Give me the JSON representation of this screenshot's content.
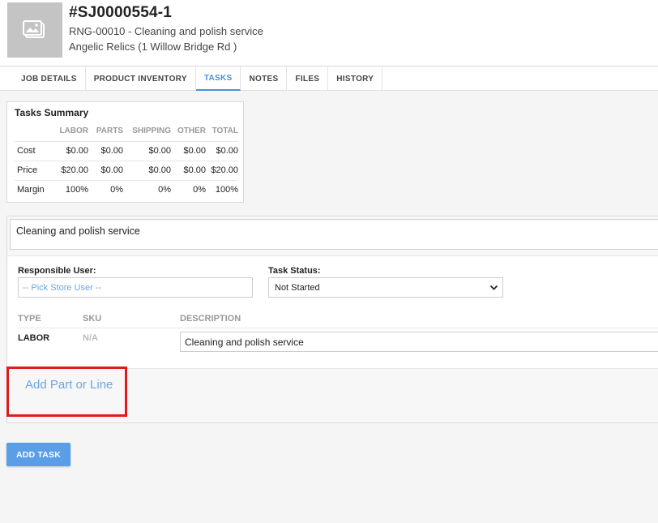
{
  "job": {
    "number": "#SJ0000554-1",
    "subtitle": "RNG-00010 - Cleaning and polish service",
    "customer": "Angelic Relics (1 Willow Bridge Rd )",
    "thumbnail_icon": "image-placeholder-icon"
  },
  "tabs": [
    {
      "label": "JOB DETAILS",
      "active": false
    },
    {
      "label": "PRODUCT INVENTORY",
      "active": false
    },
    {
      "label": "TASKS",
      "active": true
    },
    {
      "label": "NOTES",
      "active": false
    },
    {
      "label": "FILES",
      "active": false
    },
    {
      "label": "HISTORY",
      "active": false
    }
  ],
  "summary": {
    "title": "Tasks Summary",
    "columns": [
      "LABOR",
      "PARTS",
      "SHIPPING",
      "OTHER",
      "TOTAL"
    ],
    "rows": [
      {
        "label": "Cost",
        "values": [
          "$0.00",
          "$0.00",
          "$0.00",
          "$0.00",
          "$0.00"
        ]
      },
      {
        "label": "Price",
        "values": [
          "$20.00",
          "$0.00",
          "$0.00",
          "$0.00",
          "$20.00"
        ]
      },
      {
        "label": "Margin",
        "values": [
          "100%",
          "0%",
          "0%",
          "0%",
          "100%"
        ]
      }
    ]
  },
  "task": {
    "name": "Cleaning and polish service",
    "responsible_user_label": "Responsible User:",
    "responsible_user_placeholder": "-- Pick Store User --",
    "task_status_label": "Task Status:",
    "task_status_value": "Not Started",
    "columns": {
      "type": "TYPE",
      "sku": "SKU",
      "description": "DESCRIPTION"
    },
    "line": {
      "type": "LABOR",
      "sku": "N/A",
      "description": "Cleaning and polish service"
    },
    "add_part_label": "Add Part or Line"
  },
  "add_task_label": "ADD TASK",
  "colors": {
    "accent": "#4a90d9",
    "link": "#6ea6de",
    "button": "#5a9ee8",
    "highlight": "#e01b1b"
  }
}
